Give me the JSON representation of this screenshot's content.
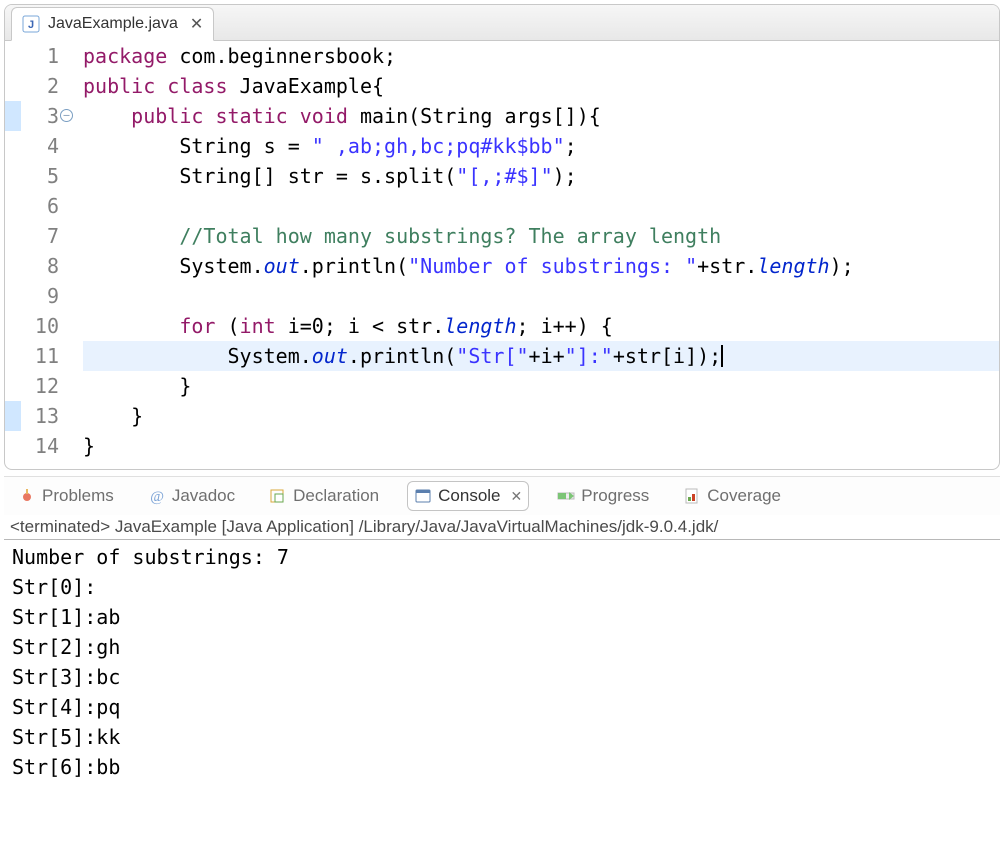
{
  "editor": {
    "tab": {
      "file_name": "JavaExample.java"
    },
    "lines": [
      {
        "num": "1",
        "indent": "",
        "strip": "",
        "fold": "",
        "tokens": [
          [
            "kw",
            "package"
          ],
          [
            "plain",
            " com.beginnersbook;"
          ]
        ]
      },
      {
        "num": "2",
        "indent": "",
        "strip": "",
        "fold": "",
        "tokens": [
          [
            "kw",
            "public"
          ],
          [
            "plain",
            " "
          ],
          [
            "kw",
            "class"
          ],
          [
            "plain",
            " JavaExample{"
          ]
        ]
      },
      {
        "num": "3",
        "indent": "    ",
        "strip": "blue",
        "fold": "minus",
        "tokens": [
          [
            "kw",
            "public"
          ],
          [
            "plain",
            " "
          ],
          [
            "kw",
            "static"
          ],
          [
            "plain",
            " "
          ],
          [
            "kw",
            "void"
          ],
          [
            "plain",
            " main(String args[]){"
          ]
        ]
      },
      {
        "num": "4",
        "indent": "        ",
        "strip": "",
        "fold": "",
        "tokens": [
          [
            "plain",
            "String s = "
          ],
          [
            "str",
            "\" ,ab;gh,bc;pq#kk$bb\""
          ],
          [
            "plain",
            ";"
          ]
        ]
      },
      {
        "num": "5",
        "indent": "        ",
        "strip": "",
        "fold": "",
        "tokens": [
          [
            "plain",
            "String[] str = s.split("
          ],
          [
            "str",
            "\"[,;#$]\""
          ],
          [
            "plain",
            ");"
          ]
        ]
      },
      {
        "num": "6",
        "indent": "",
        "strip": "",
        "fold": "",
        "tokens": []
      },
      {
        "num": "7",
        "indent": "        ",
        "strip": "",
        "fold": "",
        "tokens": [
          [
            "cmt",
            "//Total how many substrings? The array length"
          ]
        ]
      },
      {
        "num": "8",
        "indent": "        ",
        "strip": "",
        "fold": "",
        "tokens": [
          [
            "plain",
            "System."
          ],
          [
            "fld",
            "out"
          ],
          [
            "plain",
            ".println("
          ],
          [
            "str",
            "\"Number of substrings: \""
          ],
          [
            "plain",
            "+str."
          ],
          [
            "fld",
            "length"
          ],
          [
            "plain",
            ");"
          ]
        ]
      },
      {
        "num": "9",
        "indent": "",
        "strip": "",
        "fold": "",
        "tokens": []
      },
      {
        "num": "10",
        "indent": "        ",
        "strip": "",
        "fold": "",
        "tokens": [
          [
            "kw",
            "for"
          ],
          [
            "plain",
            " ("
          ],
          [
            "kw",
            "int"
          ],
          [
            "plain",
            " i=0; i < str."
          ],
          [
            "fld",
            "length"
          ],
          [
            "plain",
            "; i++) {"
          ]
        ]
      },
      {
        "num": "11",
        "indent": "            ",
        "strip": "",
        "fold": "",
        "hl": true,
        "cursor": true,
        "tokens": [
          [
            "plain",
            "System."
          ],
          [
            "fld",
            "out"
          ],
          [
            "plain",
            ".println("
          ],
          [
            "str",
            "\"Str[\""
          ],
          [
            "plain",
            "+i+"
          ],
          [
            "str",
            "\"]:\""
          ],
          [
            "plain",
            "+str[i]);"
          ]
        ]
      },
      {
        "num": "12",
        "indent": "        ",
        "strip": "",
        "fold": "",
        "tokens": [
          [
            "plain",
            "}"
          ]
        ]
      },
      {
        "num": "13",
        "indent": "    ",
        "strip": "blue",
        "fold": "",
        "tokens": [
          [
            "plain",
            "}"
          ]
        ]
      },
      {
        "num": "14",
        "indent": "",
        "strip": "",
        "fold": "",
        "tokens": [
          [
            "plain",
            "}"
          ]
        ]
      }
    ]
  },
  "bottom": {
    "views": {
      "problems": "Problems",
      "javadoc": "Javadoc",
      "declaration": "Declaration",
      "console": "Console",
      "progress": "Progress",
      "coverage": "Coverage"
    },
    "status": "<terminated> JavaExample [Java Application] /Library/Java/JavaVirtualMachines/jdk-9.0.4.jdk/",
    "output": [
      "Number of substrings: 7",
      "Str[0]:",
      "Str[1]:ab",
      "Str[2]:gh",
      "Str[3]:bc",
      "Str[4]:pq",
      "Str[5]:kk",
      "Str[6]:bb"
    ]
  }
}
